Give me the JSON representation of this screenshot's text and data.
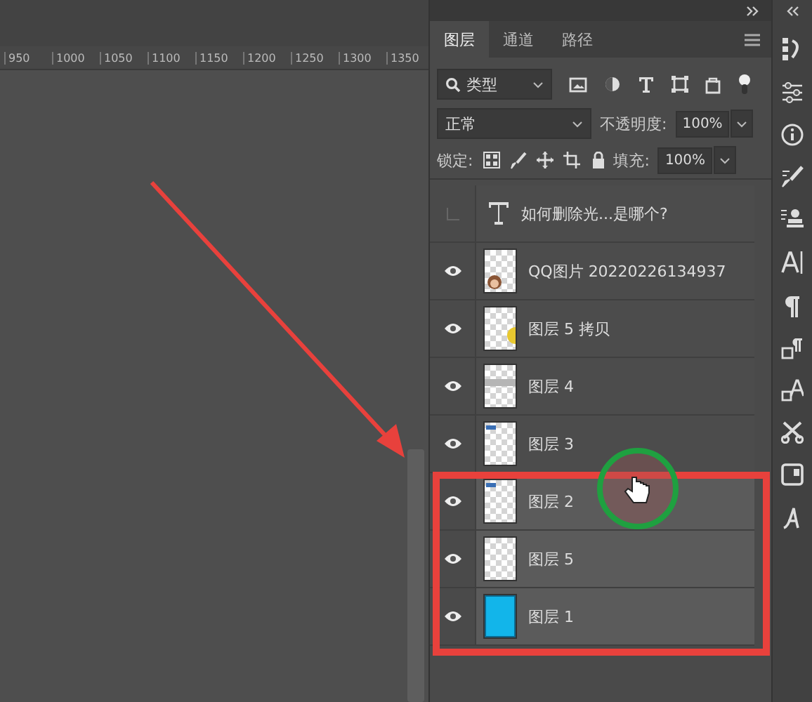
{
  "ruler": {
    "ticks": [
      "950",
      "1000",
      "1050",
      "1100",
      "1150",
      "1200",
      "1250",
      "1300",
      "1350"
    ]
  },
  "layers_panel": {
    "tabs": [
      {
        "label": "图层",
        "selected": true
      },
      {
        "label": "通道",
        "selected": false
      },
      {
        "label": "路径",
        "selected": false
      }
    ],
    "filter": {
      "value": "类型"
    },
    "blend_mode": {
      "value": "正常"
    },
    "opacity": {
      "label": "不透明度:",
      "value": "100%"
    },
    "lock": {
      "label": "锁定:"
    },
    "fill": {
      "label": "填充:",
      "value": "100%"
    },
    "layers": [
      {
        "kind": "text",
        "name": "如何删除光...是哪个?",
        "visible": false,
        "selected": false
      },
      {
        "kind": "image",
        "name": "QQ图片 20220226134937",
        "visible": true,
        "selected": false
      },
      {
        "kind": "image",
        "name": "图层 5 拷贝",
        "visible": true,
        "selected": false
      },
      {
        "kind": "image",
        "name": "图层 4",
        "visible": true,
        "selected": false
      },
      {
        "kind": "image",
        "name": "图层 3",
        "visible": true,
        "selected": false
      },
      {
        "kind": "image",
        "name": "图层 2",
        "visible": true,
        "selected": true
      },
      {
        "kind": "image",
        "name": "图层 5",
        "visible": true,
        "selected": true
      },
      {
        "kind": "image",
        "name": "图层 1",
        "visible": true,
        "selected": true
      }
    ]
  }
}
